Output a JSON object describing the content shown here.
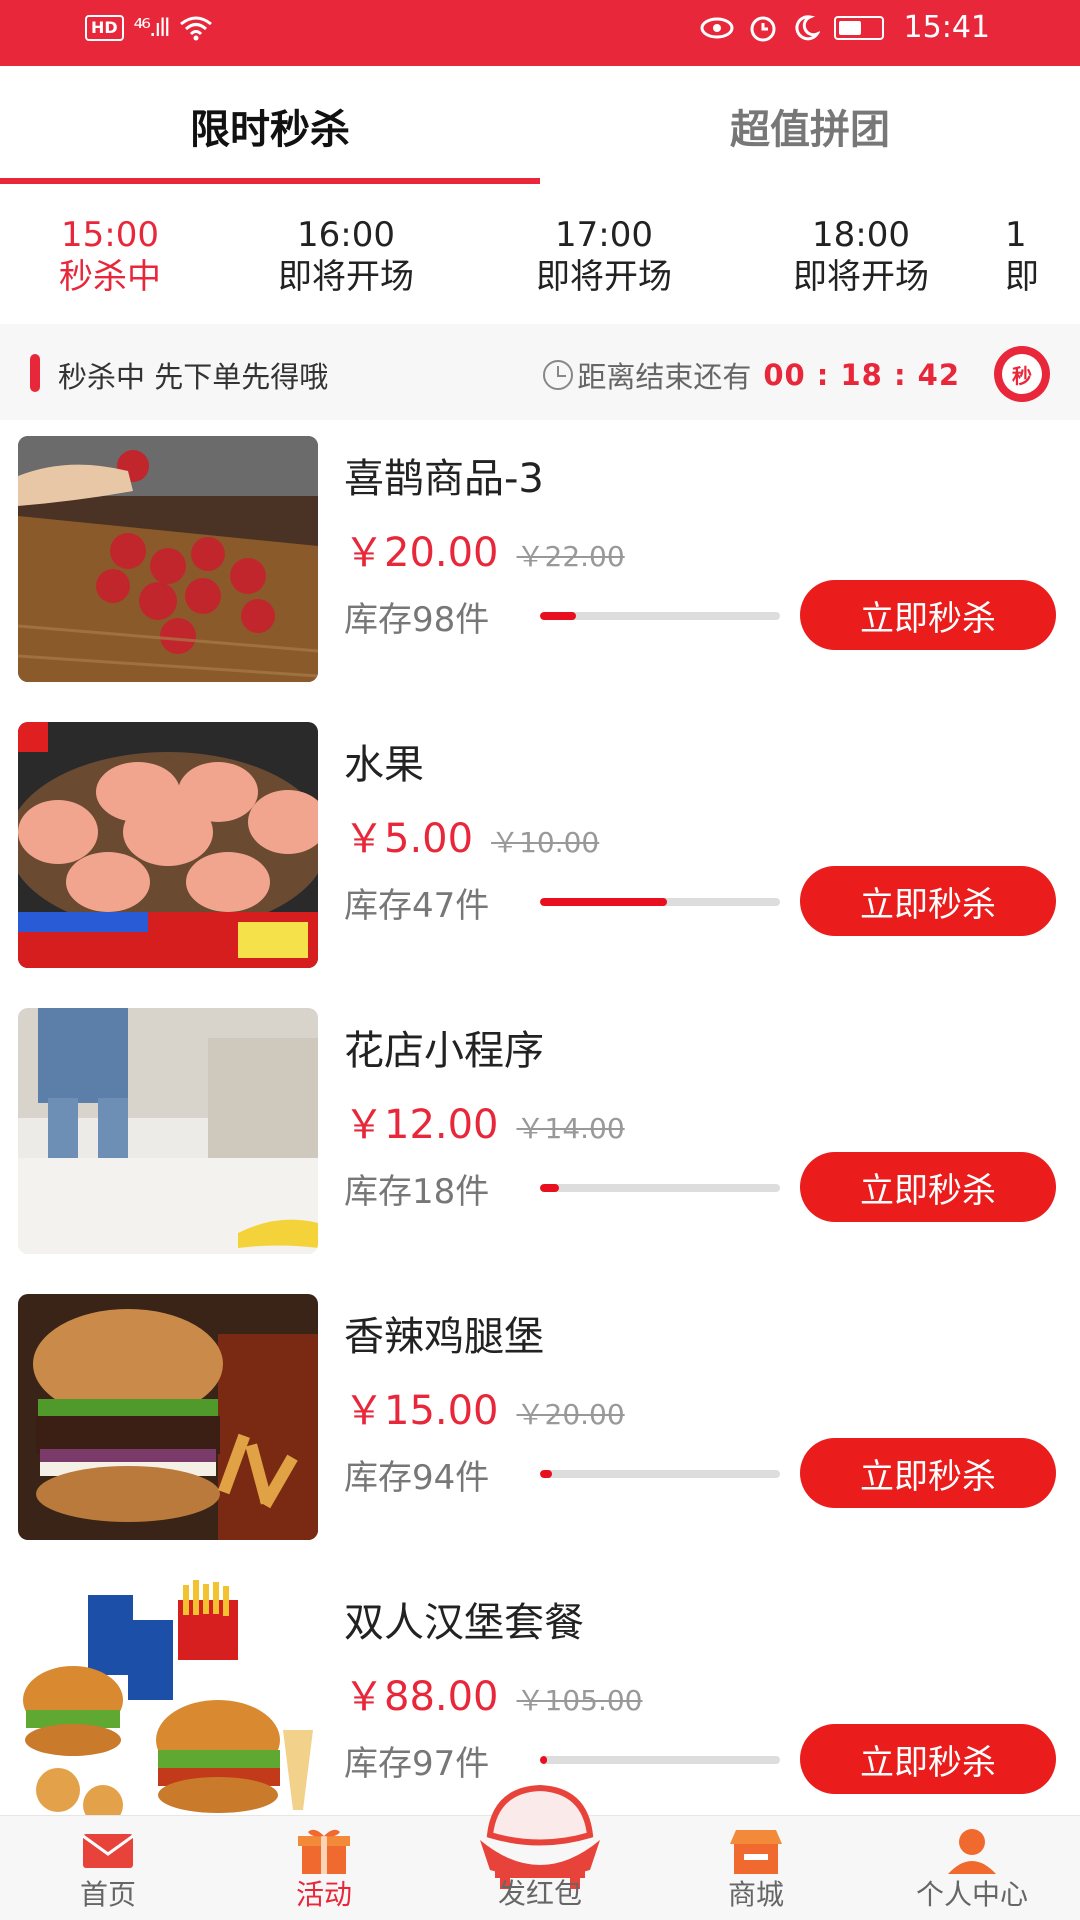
{
  "status_bar": {
    "left_hd": "HD",
    "left_signal": "⁴⁶.ıll",
    "time": "15:41"
  },
  "tabs": [
    {
      "label": "限时秒杀"
    },
    {
      "label": "超值拼团"
    }
  ],
  "slots": [
    {
      "time": "15:00",
      "status": "秒杀中"
    },
    {
      "time": "16:00",
      "status": "即将开场"
    },
    {
      "time": "17:00",
      "status": "即将开场"
    },
    {
      "time": "18:00",
      "status": "即将开场"
    },
    {
      "time": "1",
      "status": "即"
    }
  ],
  "info": {
    "text": "秒杀中 先下单先得哦",
    "timer_label": "距离结束还有",
    "countdown": "00 : 18 : 42",
    "badge": "秒"
  },
  "products": [
    {
      "name": "喜鹊商品-3",
      "price": "￥20.00",
      "orig": "￥22.00",
      "stock": "库存98件",
      "sold_fraction": 0.15,
      "button": "立即秒杀"
    },
    {
      "name": "水果",
      "price": "￥5.00",
      "orig": "￥10.00",
      "stock": "库存47件",
      "sold_fraction": 0.53,
      "button": "立即秒杀"
    },
    {
      "name": "花店小程序",
      "price": "￥12.00",
      "orig": "￥14.00",
      "stock": "库存18件",
      "sold_fraction": 0.08,
      "button": "立即秒杀"
    },
    {
      "name": "香辣鸡腿堡",
      "price": "￥15.00",
      "orig": "￥20.00",
      "stock": "库存94件",
      "sold_fraction": 0.05,
      "button": "立即秒杀"
    },
    {
      "name": "双人汉堡套餐",
      "price": "￥88.00",
      "orig": "￥105.00",
      "stock": "库存97件",
      "sold_fraction": 0.03,
      "button": "立即秒杀"
    }
  ],
  "nav": [
    {
      "label": "首页"
    },
    {
      "label": "活动"
    },
    {
      "label": "发红包"
    },
    {
      "label": "商城"
    },
    {
      "label": "个人中心"
    }
  ],
  "colors": {
    "accent": "#e8273a",
    "button": "#ea1c1c"
  }
}
